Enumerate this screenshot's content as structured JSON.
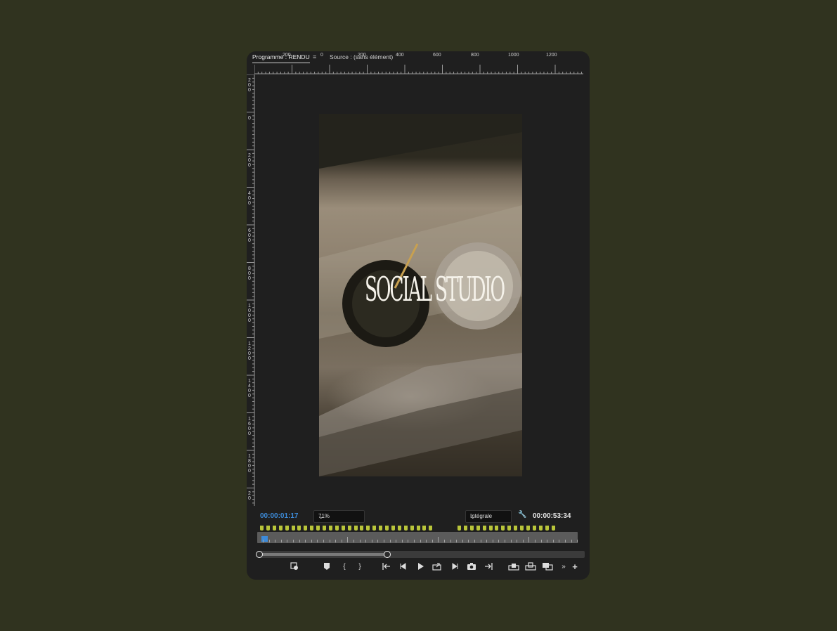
{
  "tabs": {
    "program": "Programme : RENDU",
    "menu": "≡",
    "source": "Source : (sans élément)"
  },
  "ruler_top": [
    "200",
    "0",
    "200",
    "400",
    "600",
    "800",
    "1000",
    "1200"
  ],
  "ruler_left": [
    "2\n0\n0",
    "0",
    "2\n0\n0",
    "4\n0\n0",
    "6\n0\n0",
    "8\n0\n0",
    "1\n0\n0\n0",
    "1\n2\n0\n0",
    "1\n4\n0\n0",
    "1\n6\n0\n0",
    "1\n8\n0\n0",
    "2\n0"
  ],
  "video": {
    "title": "SOCIAL STUDIO"
  },
  "playback": {
    "current_timecode": "00:00:01:17",
    "zoom": "71%",
    "quality": "Intégrale",
    "duration_timecode": "00:00:53:34"
  },
  "icons": {
    "wrench": "wrench-icon",
    "export_frame": "camera-icon"
  },
  "colors": {
    "accent": "#3d8bd9",
    "marker": "#b9c53a",
    "background": "#30331f",
    "panel": "#1f1f1f"
  }
}
